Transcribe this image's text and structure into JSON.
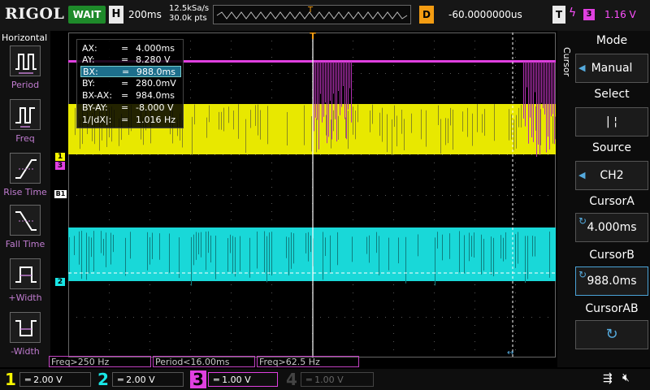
{
  "topbar": {
    "logo": "RIGOL",
    "run_state": "WAIT",
    "timebase_letter": "H",
    "timebase_value": "200ms",
    "sample_rate": "12.5kSa/s",
    "memory_depth": "30.0k pts",
    "trigger_pos_marker": "T",
    "delay_letter": "D",
    "delay_value": "-60.0000000us",
    "trigger_letter": "T",
    "trigger_source": "3",
    "trigger_level": "1.16 V"
  },
  "left_panel": {
    "title": "Horizontal",
    "items": [
      {
        "label": "Period"
      },
      {
        "label": "Freq"
      },
      {
        "label": "Rise Time"
      },
      {
        "label": "Fall Time"
      },
      {
        "label": "+Width"
      },
      {
        "label": "-Width"
      }
    ]
  },
  "cursor_info": {
    "rows": [
      {
        "name": "AX:",
        "value": "4.000ms"
      },
      {
        "name": "AY:",
        "value": "8.280 V"
      },
      {
        "name": "BX:",
        "value": "988.0ms"
      },
      {
        "name": "BY:",
        "value": "280.0mV"
      },
      {
        "name": "BX-AX:",
        "value": "984.0ms"
      },
      {
        "name": "BY-AY:",
        "value": "-8.000 V"
      },
      {
        "name": "1/|dX|:",
        "value": "1.016 Hz"
      }
    ]
  },
  "right_panel": {
    "vertical_label": "Cursor",
    "mode_title": "Mode",
    "mode_value": "Manual",
    "select_title": "Select",
    "select_value": "| ¦",
    "source_title": "Source",
    "source_value": "CH2",
    "cursora_title": "CursorA",
    "cursora_value": "4.000ms",
    "cursorb_title": "CursorB",
    "cursorb_value": "988.0ms",
    "cursorab_title": "CursorAB"
  },
  "markers": {
    "ch1": "1",
    "ch3": "3",
    "b1": "B1",
    "ch2": "2",
    "trigger": "T"
  },
  "measurements": [
    {
      "text": "Freq>250 Hz"
    },
    {
      "text": "Period<16.00ms"
    },
    {
      "text": "Freq>62.5 Hz"
    }
  ],
  "channels": [
    {
      "num": "1",
      "scale": "2.00 V",
      "color": "#f5f500"
    },
    {
      "num": "2",
      "scale": "2.00 V",
      "color": "#19e6e6"
    },
    {
      "num": "3",
      "scale": "1.00 V",
      "color": "#e040e0"
    },
    {
      "num": "4",
      "scale": "1.00 V",
      "color": "#4a78ff"
    }
  ],
  "colors": {
    "ch1": "#f5f500",
    "ch2": "#19e6e6",
    "ch3": "#e040e0",
    "trigger": "#f39c12"
  },
  "status_icons": [
    "usb-icon",
    "speaker-mute-icon"
  ]
}
